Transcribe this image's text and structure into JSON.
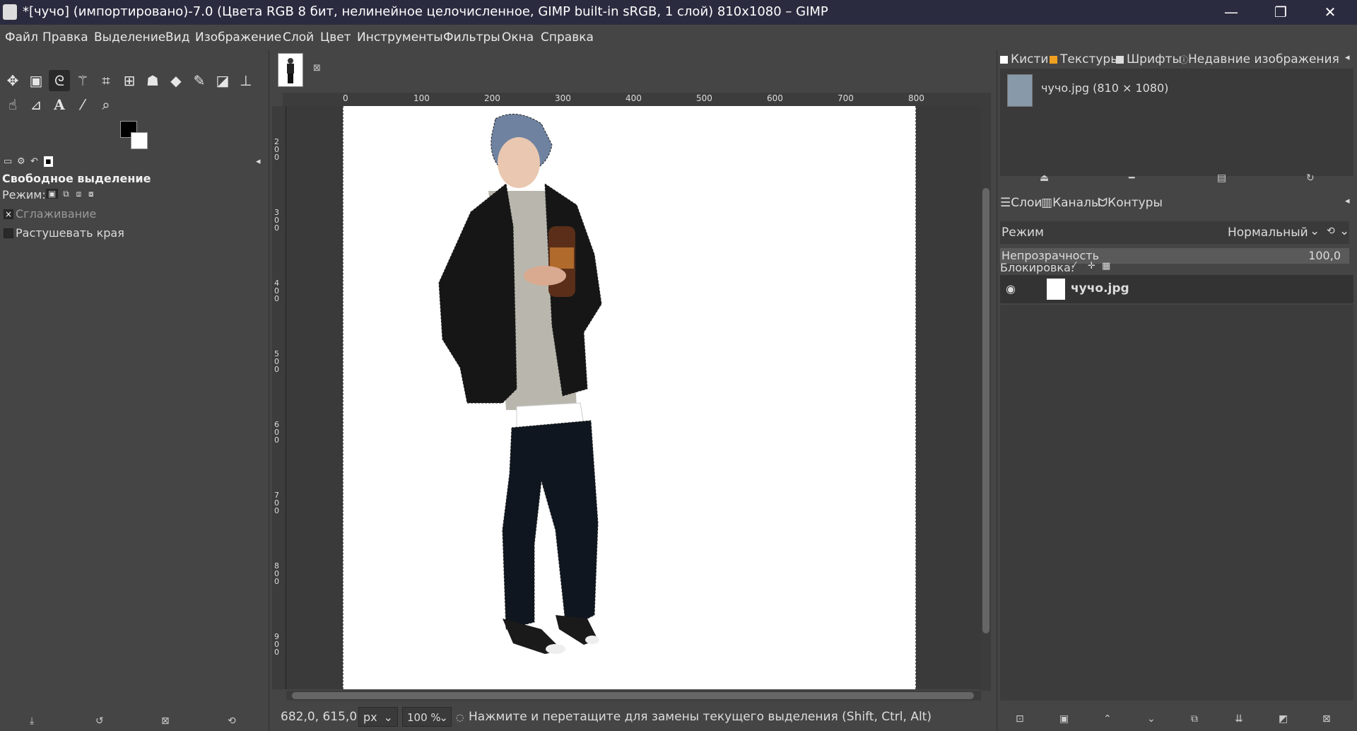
{
  "titlebar": {
    "title": "*[чучо] (импортировано)-7.0 (Цвета RGB 8 бит, нелинейное целочисленное, GIMP built-in sRGB, 1 слой) 810x1080 – GIMP",
    "minimize": "—",
    "restore": "❐",
    "close": "✕"
  },
  "menu": [
    "Файл",
    "Правка",
    "Выделение",
    "Вид",
    "Изображение",
    "Слой",
    "Цвет",
    "Инструменты",
    "Фильтры",
    "Окна",
    "Справка"
  ],
  "toolbox": {
    "tools_row1": [
      "move-icon",
      "rect-select-icon",
      "free-select-icon",
      "fuzzy-select-icon",
      "crop-icon",
      "unified-transform-icon",
      "warp-icon",
      "bucket-fill-icon",
      "paintbrush-icon",
      "eraser-icon",
      "clone-icon"
    ],
    "tools_row2": [
      "smudge-icon",
      "path-icon",
      "text-icon",
      "color-picker-icon",
      "zoom-icon"
    ],
    "fg_color": "#000000",
    "bg_color": "#ffffff"
  },
  "tool_options": {
    "title": "Свободное выделение",
    "mode_label": "Режим:",
    "antialias_label": "Сглаживание",
    "antialias_checked": true,
    "feather_label": "Растушевать края",
    "feather_checked": false
  },
  "ruler": {
    "h_labels": [
      "0",
      "100",
      "200",
      "300",
      "400",
      "500",
      "600",
      "700",
      "800"
    ],
    "v_labels": [
      "2\n0\n0",
      "3\n0\n0",
      "4\n0\n0",
      "5\n0\n0",
      "6\n0\n0",
      "7\n0\n0",
      "8\n0\n0",
      "9\n0\n0"
    ]
  },
  "statusbar": {
    "coords": "682,0, 615,0",
    "unit": "px",
    "zoom": "100 %",
    "message": "Нажмите и перетащите для замены текущего выделения (Shift, Ctrl, Alt)"
  },
  "right_top": {
    "tabs": [
      "Кисти",
      "Текстуры",
      "Шрифты",
      "Недавние изображения"
    ],
    "recent_item": "чучо.jpg (810 × 1080)"
  },
  "layers": {
    "tabs": [
      "Слои",
      "Каналы",
      "Контуры"
    ],
    "mode_label": "Режим",
    "mode_value": "Нормальный",
    "opacity_label": "Непрозрачность",
    "opacity_value": "100,0",
    "lock_label": "Блокировка:",
    "layer_name": "чучо.jpg"
  }
}
